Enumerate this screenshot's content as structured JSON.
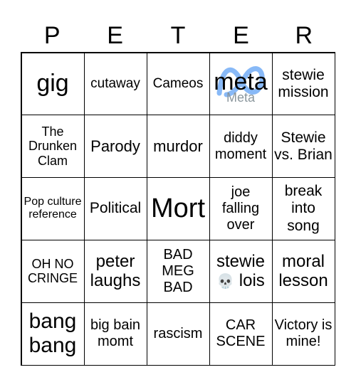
{
  "header": [
    "P",
    "E",
    "T",
    "E",
    "R"
  ],
  "cells": [
    "gig",
    "cutaway",
    "Cameos",
    "meta",
    "stewie mission",
    "The Drunken Clam",
    "Parody",
    "murdor",
    "diddy moment",
    "Stewie vs. Brian",
    "Pop culture reference",
    "Political",
    "Mort",
    "joe falling over",
    "break into song",
    "OH NO CRINGE",
    "peter laughs",
    "BAD MEG BAD",
    "stewie 💀 lois",
    "moral lesson",
    "bang bang",
    "big bain momt",
    "rascism",
    "CAR SCENE",
    "Victory is mine!"
  ],
  "meta_logo": {
    "wordmark": "Meta",
    "color": "#6aa8f5"
  },
  "skull_icon": "skull-icon"
}
